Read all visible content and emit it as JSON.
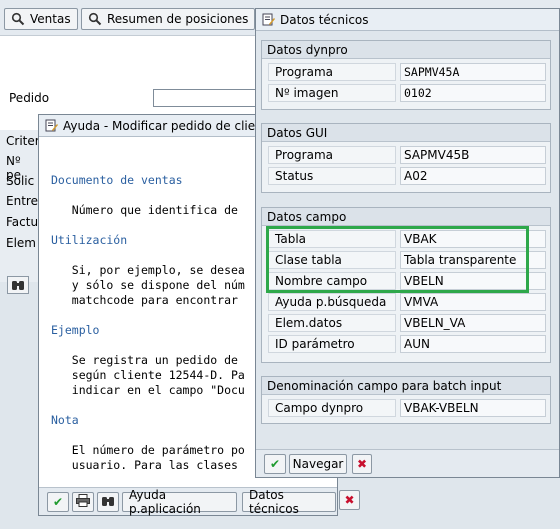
{
  "toolbar": {
    "ventas_label": "Ventas",
    "resumen_label": "Resumen de posiciones"
  },
  "main": {
    "pedido_label": "Pedido",
    "criteria": [
      "Criter",
      "Nº pe",
      "Solic",
      "Entre",
      "Factu",
      "Elem"
    ]
  },
  "help": {
    "title": "Ayuda - Modificar pedido de cliente:",
    "lines": [
      {
        "text": "Documento de ventas",
        "head": true
      },
      {
        "text": "",
        "head": false
      },
      {
        "text": "   Número que identifica de",
        "head": false
      },
      {
        "text": "",
        "head": false
      },
      {
        "text": "Utilización",
        "head": true
      },
      {
        "text": "",
        "head": false
      },
      {
        "text": "   Si, por ejemplo, se desea",
        "head": false
      },
      {
        "text": "   y sólo se dispone del núm",
        "head": false
      },
      {
        "text": "   matchcode para encontrar",
        "head": false
      },
      {
        "text": "",
        "head": false
      },
      {
        "text": "Ejemplo",
        "head": true
      },
      {
        "text": "",
        "head": false
      },
      {
        "text": "   Se registra un pedido de",
        "head": false
      },
      {
        "text": "   según cliente 12544-D. Pa",
        "head": false
      },
      {
        "text": "   indicar en el campo \"Docu",
        "head": false
      },
      {
        "text": "",
        "head": false
      },
      {
        "text": "Nota",
        "head": true
      },
      {
        "text": "",
        "head": false
      },
      {
        "text": "   El número de parámetro po",
        "head": false
      },
      {
        "text": "   usuario. Para las clases",
        "head": false
      }
    ],
    "footer": {
      "ayuda_label": "Ayuda p.aplicación",
      "datos_label": "Datos técnicos"
    }
  },
  "tech": {
    "title": "Datos técnicos",
    "dynpro": {
      "title": "Datos dynpro",
      "programa_label": "Programa",
      "programa_value": "SAPMV45A",
      "imagen_label": "Nº imagen",
      "imagen_value": "0102"
    },
    "gui": {
      "title": "Datos GUI",
      "programa_label": "Programa",
      "programa_value": "SAPMV45B",
      "status_label": "Status",
      "status_value": "A02"
    },
    "campo": {
      "title": "Datos campo",
      "tabla_label": "Tabla",
      "tabla_value": "VBAK",
      "clase_label": "Clase tabla",
      "clase_value": "Tabla transparente",
      "nombre_label": "Nombre campo",
      "nombre_value": "VBELN",
      "ayuda_label": "Ayuda p.búsqueda",
      "ayuda_value": "VMVA",
      "elem_label": "Elem.datos",
      "elem_value": "VBELN_VA",
      "id_label": "ID parámetro",
      "id_value": "AUN"
    },
    "batch": {
      "title": "Denominación campo para batch input",
      "campo_label": "Campo dynpro",
      "campo_value": "VBAK-VBELN"
    },
    "footer": {
      "navegar_label": "Navegar"
    }
  },
  "colors": {
    "highlight": "#2ea84a",
    "heading_blue": "#2a5fa0"
  }
}
